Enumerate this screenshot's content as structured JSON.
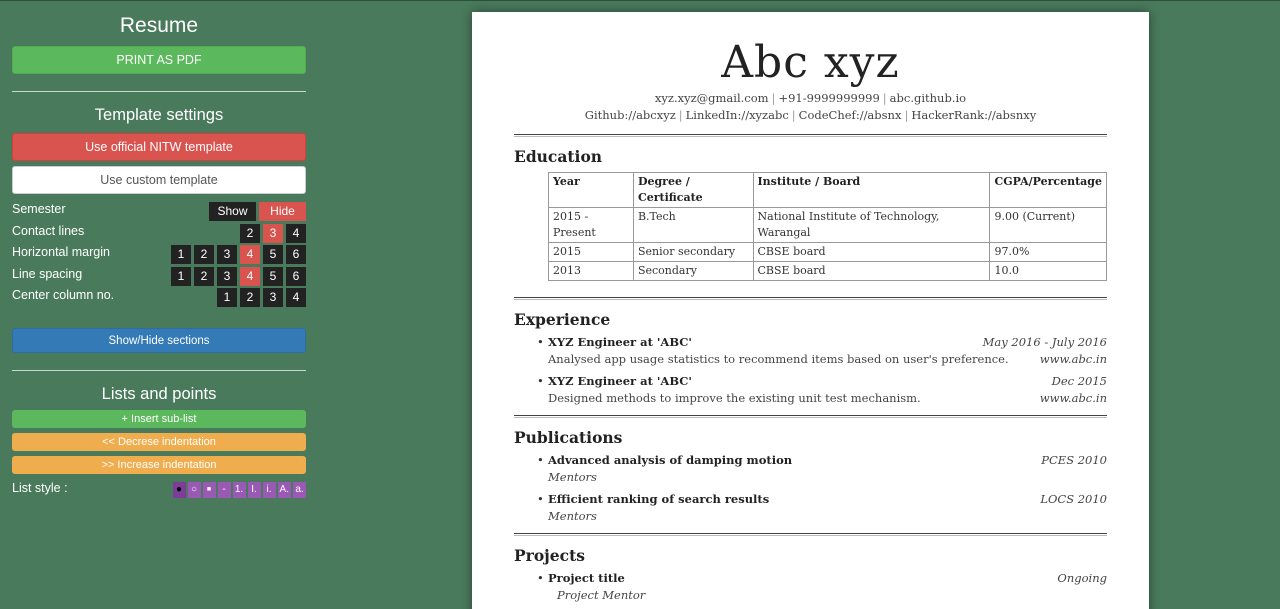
{
  "sidebar": {
    "title": "Resume",
    "print_label": "PRINT AS PDF",
    "template_heading": "Template settings",
    "official_template_label": "Use official NITW template",
    "custom_template_label": "Use custom template",
    "settings": {
      "semester": {
        "label": "Semester",
        "options": [
          "Show",
          "Hide"
        ],
        "selected": "Hide"
      },
      "contact_lines": {
        "label": "Contact lines",
        "options": [
          "2",
          "3",
          "4"
        ],
        "selected": "3"
      },
      "horizontal_margin": {
        "label": "Horizontal margin",
        "options": [
          "1",
          "2",
          "3",
          "4",
          "5",
          "6"
        ],
        "selected": "4"
      },
      "line_spacing": {
        "label": "Line spacing",
        "options": [
          "1",
          "2",
          "3",
          "4",
          "5",
          "6"
        ],
        "selected": "4"
      },
      "center_column": {
        "label": "Center column no.",
        "options": [
          "1",
          "2",
          "3",
          "4"
        ],
        "selected": ""
      }
    },
    "show_hide_label": "Show/Hide sections",
    "lists_heading": "Lists and points",
    "insert_sublist_label": "+ Insert sub-list",
    "decrease_indent_label": "<< Decrese indentation",
    "increase_indent_label": ">> Increase indentation",
    "list_style": {
      "label": "List style :",
      "options": [
        "●",
        "○",
        "■",
        "-",
        "1.",
        "I.",
        "i.",
        "A.",
        "a."
      ]
    }
  },
  "resume": {
    "name": "Abc xyz",
    "contact_line1": [
      "xyz.xyz@gmail.com",
      "+91-9999999999",
      "abc.github.io"
    ],
    "contact_line2": [
      "Github://abcxyz",
      "LinkedIn://xyzabc",
      "CodeChef://absnx",
      "HackerRank://absnxy"
    ],
    "sections": {
      "education": {
        "title": "Education",
        "headers": [
          "Year",
          "Degree / Certificate",
          "Institute / Board",
          "CGPA/Percentage"
        ],
        "rows": [
          [
            "2015 - Present",
            "B.Tech",
            "National Institute of Technology, Warangal",
            "9.00 (Current)"
          ],
          [
            "2015",
            "Senior secondary",
            "CBSE board",
            "97.0%"
          ],
          [
            "2013",
            "Secondary",
            "CBSE board",
            "10.0"
          ]
        ]
      },
      "experience": {
        "title": "Experience",
        "items": [
          {
            "title": "XYZ Engineer at 'ABC'",
            "date": "May 2016 - July 2016",
            "desc": "Analysed app usage statistics to recommend items based on user's preference.",
            "link": "www.abc.in"
          },
          {
            "title": "XYZ Engineer at 'ABC'",
            "date": "Dec 2015",
            "desc": "Designed methods to improve the existing unit test mechanism.",
            "link": "www.abc.in"
          }
        ]
      },
      "publications": {
        "title": "Publications",
        "items": [
          {
            "title": "Advanced analysis of damping motion",
            "venue": "PCES 2010",
            "sub": "Mentors"
          },
          {
            "title": "Efficient ranking of search results",
            "venue": "LOCS 2010",
            "sub": "Mentors"
          }
        ]
      },
      "projects": {
        "title": "Projects",
        "items": [
          {
            "title": "Project title",
            "status": "Ongoing",
            "sub": "Project Mentor"
          }
        ]
      }
    }
  },
  "colors": {
    "background": "#4a7a5c",
    "green_button": "#5cb85c",
    "red_button": "#d9534f",
    "blue_button": "#337ab7",
    "orange_button": "#f0ad4e",
    "purple_option": "#9b59b6"
  }
}
